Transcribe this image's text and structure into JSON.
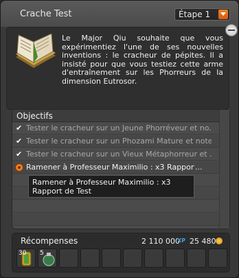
{
  "window": {
    "title": "Crache Test"
  },
  "stage": {
    "selected": "Étape 1"
  },
  "description": "Le Major Qiu souhaite que vous expérimentiez l'une de ses nouvelles inventions : le cracheur de pépites. Il a insisté pour que vous testiez cette arme d'entraînement sur les Phorreurs de la dimension Eutrosor.",
  "objectives": {
    "title": "Objectifs",
    "items": [
      {
        "text": "Tester le cracheur sur un Jeune Phorréveur et no...",
        "done": true
      },
      {
        "text": "Tester le cracheur sur un Phozami Mature et notez...",
        "done": true
      },
      {
        "text": "Tester le cracheur sur un Vieux Métaphorreur et ...",
        "done": true
      },
      {
        "text": "Ramener à Professeur Maximilio : x3 Rapport de",
        "more": "...",
        "done": false
      }
    ]
  },
  "tooltip": {
    "text": "Ramener à Professeur Maximilio : x3 Rapport de Test"
  },
  "rewards": {
    "title": "Récompenses",
    "xp": "2 110 000",
    "xp_label": "XP",
    "kamas": "25 480",
    "items": [
      {
        "qty": "30",
        "icon": "golden-scroll-icon"
      },
      {
        "qty": "5",
        "icon": "green-potion-icon"
      }
    ]
  },
  "icons": {
    "quest": "open-book-icon",
    "close": "minus-circle-icon",
    "check": "checkmark-icon",
    "alert": "alert-icon",
    "dropdown": "chevron-down-icon",
    "kamas": "kamas-coin-icon"
  },
  "colors": {
    "accent": "#e8721c",
    "xp": "#4aa0d8"
  }
}
